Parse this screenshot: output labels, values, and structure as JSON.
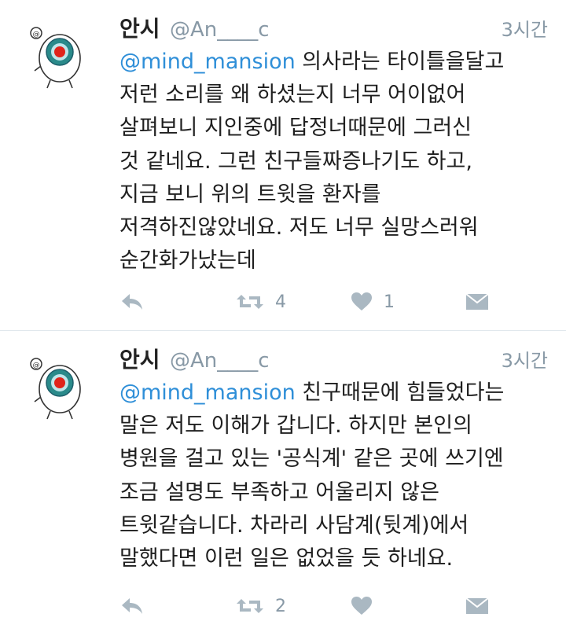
{
  "tweets": [
    {
      "name": "안시",
      "handle": "@An____c",
      "time": "3시간",
      "mention": "@mind_mansion",
      "text": " 의사라는 타이틀을달고\n저런 소리를 왜 하셨는지 너무 어이없어\n살펴보니 지인중에 답정너때문에 그러신\n것 같네요. 그런 친구들짜증나기도 하고,\n지금 보니 위의 트윗을 환자를\n저격하진않았네요. 저도 너무 실망스러워\n순간화가났는데",
      "retweets": "4",
      "likes": "1",
      "avatar_icon": "eyeball-character-icon"
    },
    {
      "name": "안시",
      "handle": "@An____c",
      "time": "3시간",
      "mention": "@mind_mansion",
      "text": " 친구때문에 힘들었다는\n말은 저도 이해가 갑니다. 하지만 본인의\n병원을 걸고 있는 '공식계' 같은 곳에 쓰기엔\n조금 설명도 부족하고 어울리지 않은\n트윗같습니다. 차라리 사담계(뒷계)에서\n말했다면 이런 일은 없었을 듯 하네요.",
      "retweets": "2",
      "likes": "",
      "avatar_icon": "eyeball-character-icon"
    }
  ],
  "icons": {
    "reply": "reply-icon",
    "retweet": "retweet-icon",
    "like": "heart-icon",
    "dm": "envelope-icon"
  },
  "colors": {
    "mention": "#2f8fd8",
    "meta": "#8899a6",
    "icon": "#aab8c2",
    "divider": "#e1e8ed"
  }
}
